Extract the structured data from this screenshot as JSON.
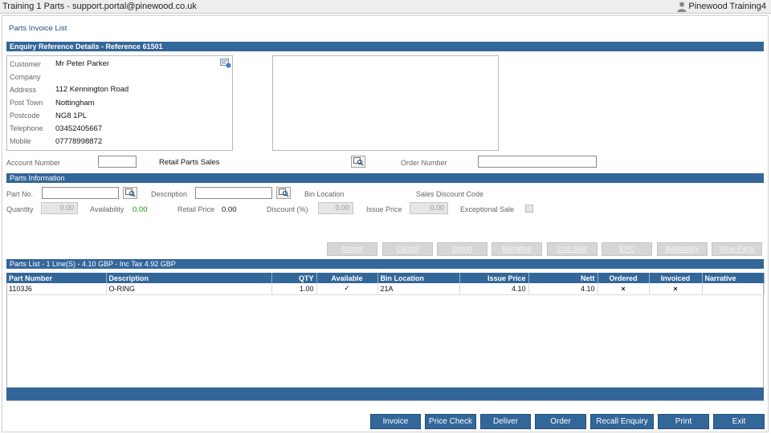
{
  "window": {
    "title": "Training 1 Parts - support.portal@pinewood.co.uk",
    "user_name": "Pinewood Training4",
    "user_icon": "person-icon"
  },
  "page": {
    "title": "Parts Invoice List"
  },
  "enquiry": {
    "header": "Enquiry Reference Details  -  Reference 61501",
    "customer_label": "Customer",
    "customer": "Mr Peter Parker",
    "company_label": "Company",
    "company": "",
    "address_label": "Address",
    "address": "112 Kennington Road",
    "post_town_label": "Post Town",
    "post_town": "Nottingham",
    "postcode_label": "Postcode",
    "postcode": "NG8 1PL",
    "telephone_label": "Telephone",
    "telephone": "03452405667",
    "mobile_label": "Mobile",
    "mobile": "07778998872",
    "edit_icon": "edit-customer-icon",
    "account_number_label": "Account Number",
    "account_number": "",
    "sales_type": "Retail Parts Sales",
    "order_number_label": "Order Number",
    "order_number": ""
  },
  "parts_info": {
    "header": "Parts Information",
    "part_no_label": "Part No.",
    "description_label": "Description",
    "bin_location_label": "Bin Location",
    "sales_discount_code_label": "Sales Discount Code",
    "quantity_label": "Quantity",
    "quantity": "0.00",
    "availability_label": "Availability",
    "availability": "0.00",
    "retail_price_label": "Retail Price",
    "retail_price": "0.00",
    "discount_label": "Discount (%)",
    "discount": "0.00",
    "issue_price_label": "Issue Price",
    "issue_price": "0.00",
    "exceptional_sale_label": "Exceptional Sale"
  },
  "actions": {
    "accept": "Accept",
    "cancel": "Cancel",
    "import": "Import",
    "narrative": "Narrative",
    "lost_sale": "Lost Sale",
    "epc": "EPC",
    "availability": "Availability",
    "view_parts": "View Parts"
  },
  "parts_list": {
    "header": "Parts List - 1 Line(S) - 4.10 GBP - Inc Tax 4.92 GBP",
    "columns": [
      "Part Number",
      "Description",
      "QTY",
      "Available",
      "Bin Location",
      "Issue Price",
      "Nett",
      "Ordered",
      "Invoiced",
      "Narrative"
    ],
    "rows": [
      {
        "part_number": "1103J6",
        "description": "O-RING",
        "qty": "1.00",
        "available": "✓",
        "bin_location": "21A",
        "issue_price": "4.10",
        "nett": "4.10",
        "ordered": "×",
        "invoiced": "×",
        "narrative": ""
      }
    ]
  },
  "buttons": {
    "invoice": "Invoice",
    "price_check": "Price Check",
    "deliver": "Deliver",
    "order": "Order",
    "recall_enquiry": "Recall Enquiry",
    "print": "Print",
    "exit": "Exit"
  },
  "colors": {
    "accent": "#336699",
    "available": "#2e9e2e",
    "flag": "#d92020"
  }
}
